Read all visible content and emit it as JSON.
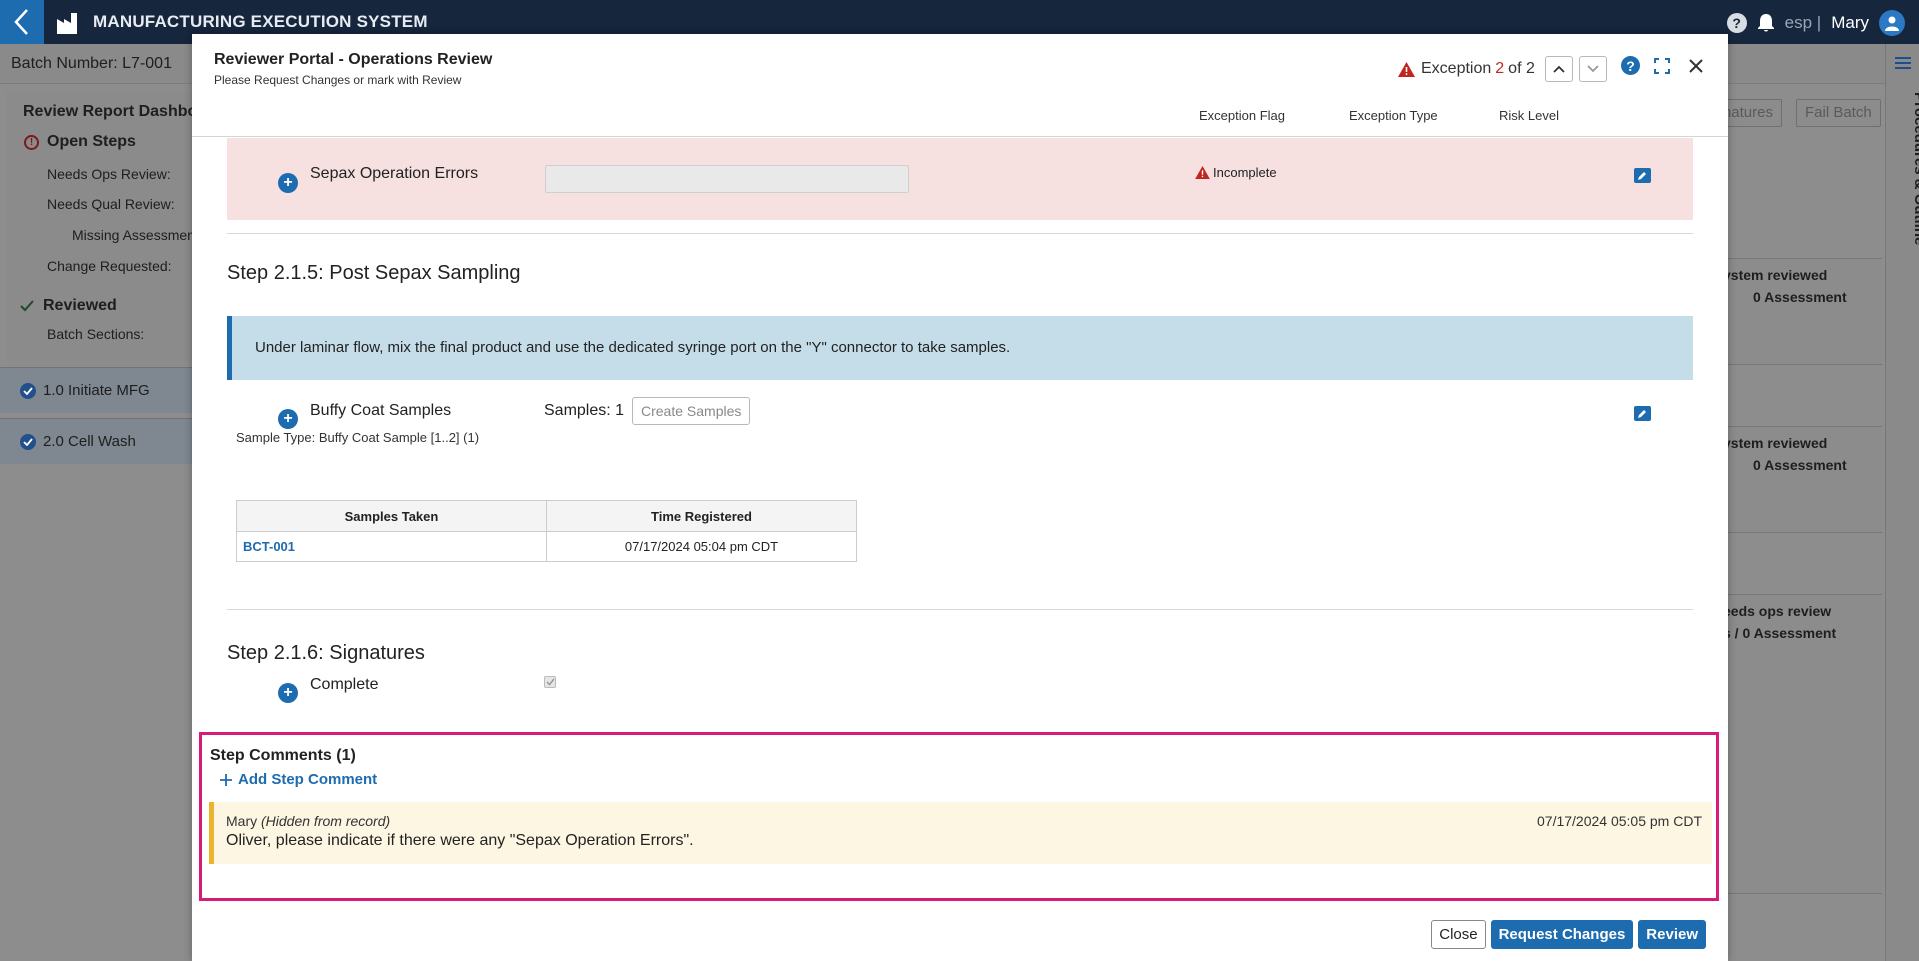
{
  "app": {
    "title": "MANUFACTURING EXECUTION SYSTEM",
    "language": "esp",
    "separator": "|",
    "user": "Mary"
  },
  "background": {
    "batch_number": "Batch Number: L7-001",
    "buttons": {
      "signatures": "natures",
      "fail_batch": "Fail Batch"
    },
    "dashboard": {
      "title": "Review Report Dashboard",
      "open_steps": "Open Steps",
      "needs_ops": "Needs Ops Review:",
      "needs_qual": "Needs Qual Review:",
      "missing_assessment": "Missing Assessment",
      "change_requested": "Change Requested:",
      "reviewed": "Reviewed",
      "batch_sections": "Batch Sections:"
    },
    "sections": [
      "1.0 Initiate MFG",
      "2.0 Cell Wash"
    ],
    "cards": [
      {
        "line1": "ystem reviewed",
        "line2": "0 Assessment"
      },
      {
        "line1": "ystem reviewed",
        "line2": "0 Assessment"
      },
      {
        "line1": "eeds ops review",
        "line2": "s / 0 Assessment"
      }
    ],
    "rail_label": "Procedures & Outline"
  },
  "modal": {
    "title": "Reviewer Portal - Operations Review",
    "subtitle": "Please Request Changes or mark with Review",
    "exception": {
      "prefix": "Exception",
      "current": "2",
      "of": "of 2"
    },
    "columns": {
      "flag": "Exception Flag",
      "type": "Exception Type",
      "risk": "Risk Level"
    },
    "error_row": {
      "label": "Sepax Operation Errors",
      "status": "Incomplete"
    },
    "step_215": {
      "title": "Step 2.1.5: Post Sepax Sampling",
      "instruction": "Under laminar flow, mix the final product and use the dedicated syringe port on the \"Y\" connector to take samples.",
      "item_label": "Buffy Coat Samples",
      "samples_count": "Samples: 1",
      "create_button": "Create Samples",
      "sample_type": "Sample Type: Buffy Coat Sample [1..2] (1)",
      "table": {
        "headers": [
          "Samples Taken",
          "Time Registered"
        ],
        "rows": [
          [
            "BCT-001",
            "07/17/2024 05:04 pm CDT"
          ]
        ]
      }
    },
    "step_216": {
      "title": "Step 2.1.6: Signatures",
      "item_label": "Complete"
    },
    "comments": {
      "title": "Step Comments (1)",
      "add_label": "Add Step Comment",
      "items": [
        {
          "author": "Mary",
          "note": "(Hidden from record)",
          "time": "07/17/2024 05:05 pm CDT",
          "text": "Oliver, please indicate if there were any \"Sepax Operation Errors\"."
        }
      ]
    },
    "footer": {
      "close": "Close",
      "request_changes": "Request Changes",
      "review": "Review"
    }
  },
  "colors": {
    "accent": "#1d6cb0",
    "error_bg": "#f6e0e0",
    "highlight": "#d81b7a",
    "comment_bar": "#e9b52c"
  }
}
